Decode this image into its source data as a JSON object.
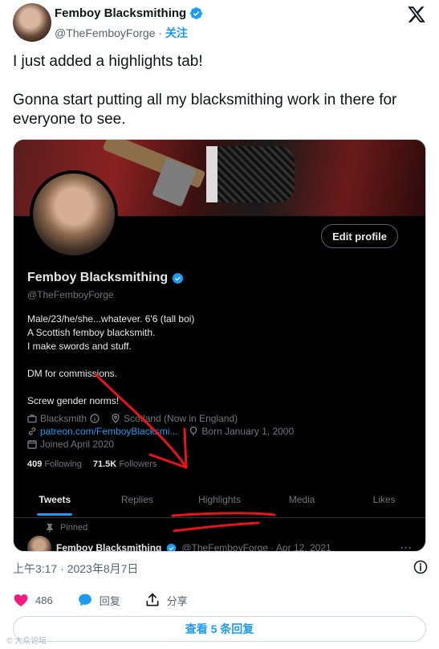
{
  "author": {
    "name": "Femboy Blacksmithing",
    "handle": "@TheFemboyForge",
    "separator": "·",
    "follow_label": "关注"
  },
  "tweet": {
    "paragraphs": [
      "I just added a highlights tab!",
      "Gonna start putting all my blacksmithing work in there for everyone to see."
    ],
    "timestamp": "上午3:17 · 2023年8月7日"
  },
  "screenshot": {
    "edit_profile_label": "Edit profile",
    "name": "Femboy Blacksmithing",
    "handle": "@TheFemboyForge",
    "bio_lines": [
      "Male/23/he/she...whatever. 6'6 (tall boi)",
      "A Scottish femboy blacksmith.",
      "I make swords and stuff.",
      "",
      "DM for commissions.",
      "",
      "Screw gender norms!"
    ],
    "meta": {
      "profession": "Blacksmith",
      "location": "Scotland (Now in England)",
      "link": "patreon.com/FemboyBlacksmi...",
      "born": "Born January 1, 2000",
      "joined": "Joined April 2020"
    },
    "following_count": "409",
    "following_label": "Following",
    "followers_count": "71.5K",
    "followers_label": "Followers",
    "tabs": [
      "Tweets",
      "Replies",
      "Highlights",
      "Media",
      "Likes"
    ],
    "active_tab": "Tweets",
    "pinned_label": "Pinned",
    "pinned_tweet": {
      "name": "Femboy Blacksmithing",
      "handle_date": "@TheFemboyForge · Apr 12, 2021",
      "more": "···"
    }
  },
  "stats": {
    "likes": "486",
    "reply_label": "回复",
    "share_label": "分享"
  },
  "view_replies_label": "查看 5 条回复",
  "watermark": "© 大众论坛",
  "colors": {
    "accent": "#1d9bf0",
    "like": "#f91880",
    "annotation_red": "#e8141b"
  }
}
